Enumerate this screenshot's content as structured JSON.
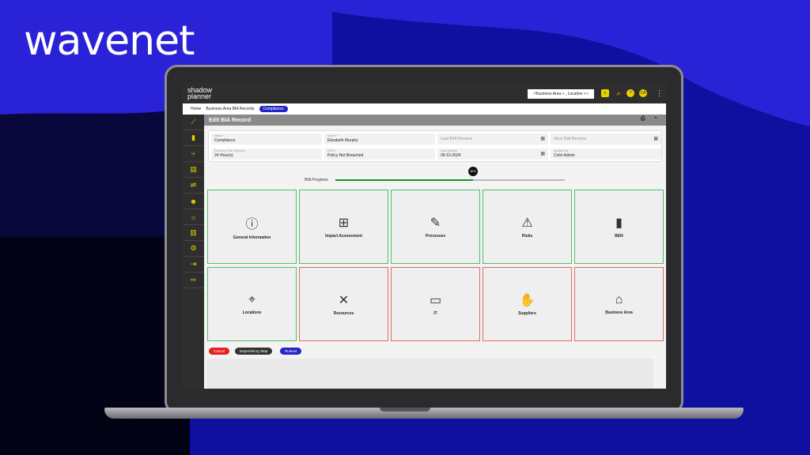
{
  "brand": {
    "logo_text": "wavenet"
  },
  "app": {
    "logo_line1": "shadow",
    "logo_line2": "planner",
    "area_selector": "/ Business Area + , Location + /",
    "header_icons": [
      {
        "name": "report-icon",
        "glyph": "≡"
      },
      {
        "name": "search-icon",
        "glyph": "⌕"
      },
      {
        "name": "help-icon",
        "glyph": "?"
      },
      {
        "name": "user-avatar",
        "glyph": "CA"
      }
    ]
  },
  "breadcrumb": [
    "Home",
    "Business Area BIA Records",
    "Compliance"
  ],
  "sidebar": {
    "items": [
      {
        "name": "dashboard-icon",
        "glyph": "⟋"
      },
      {
        "name": "documents-icon",
        "glyph": "▮"
      },
      {
        "name": "network-icon",
        "glyph": "⑂"
      },
      {
        "name": "file-icon",
        "glyph": "▤"
      },
      {
        "name": "filter-icon",
        "glyph": "⇌"
      },
      {
        "name": "users-icon",
        "glyph": "☻"
      },
      {
        "name": "signal-icon",
        "glyph": "☼"
      },
      {
        "name": "book-icon",
        "glyph": "▥"
      },
      {
        "name": "settings-icon",
        "glyph": "⚙"
      },
      {
        "name": "login-icon",
        "glyph": "⇥"
      },
      {
        "name": "logout-icon",
        "glyph": "⇨"
      }
    ]
  },
  "page": {
    "title": "Edit  BIA Record"
  },
  "form": {
    "name_label": "Name *",
    "name_value": "Compliance",
    "owner_label": "Owner *",
    "owner_value": "Elizabeth Murphy",
    "last_review_placeholder": "Last BIA Review",
    "next_review_placeholder": "Next BIA Review",
    "rto_label": "Recovery Time Objective",
    "rto_value": "24 Hour(s)",
    "mtpd_label": "MTPD",
    "mtpd_value": "Policy Not Breached",
    "last_updated_label": "Last Updated",
    "last_updated_value": "09-10-2024",
    "updated_by_label": "Updated By",
    "updated_by_value": "Colin Admin"
  },
  "progress": {
    "label": "BIA Progress:",
    "value_text": "60%",
    "value": 0.6
  },
  "tiles": [
    {
      "label": "General Information",
      "icon": "info-icon",
      "glyph": "ⓘ",
      "status": "complete"
    },
    {
      "label": "Impact Assessment",
      "icon": "flowchart-icon",
      "glyph": "⊞",
      "status": "complete"
    },
    {
      "label": "Processes",
      "icon": "process-icon",
      "glyph": "✎",
      "status": "complete"
    },
    {
      "label": "Risks",
      "icon": "warning-icon",
      "glyph": "⚠",
      "status": "complete"
    },
    {
      "label": "BEN",
      "icon": "bookmark-icon",
      "glyph": "▮",
      "status": "complete"
    },
    {
      "label": "Locations",
      "icon": "location-pin-icon",
      "glyph": "⌖",
      "status": "complete"
    },
    {
      "label": "Resources",
      "icon": "tools-icon",
      "glyph": "✕",
      "status": "incomplete"
    },
    {
      "label": "IT",
      "icon": "laptop-icon",
      "glyph": "▭",
      "status": "incomplete"
    },
    {
      "label": "Suppliers",
      "icon": "handshake-icon",
      "glyph": "✋",
      "status": "incomplete"
    },
    {
      "label": "Business Area",
      "icon": "store-icon",
      "glyph": "⌂",
      "status": "incomplete"
    }
  ],
  "buttons": {
    "cancel": "Cancel",
    "dependency_map": "Dependency Map",
    "ruleset": "Ruleset"
  },
  "colors": {
    "complete_border": "#4fbf6a",
    "incomplete_border": "#e06d62",
    "accent": "#2323c8",
    "icon_yellow": "#e8d000"
  }
}
